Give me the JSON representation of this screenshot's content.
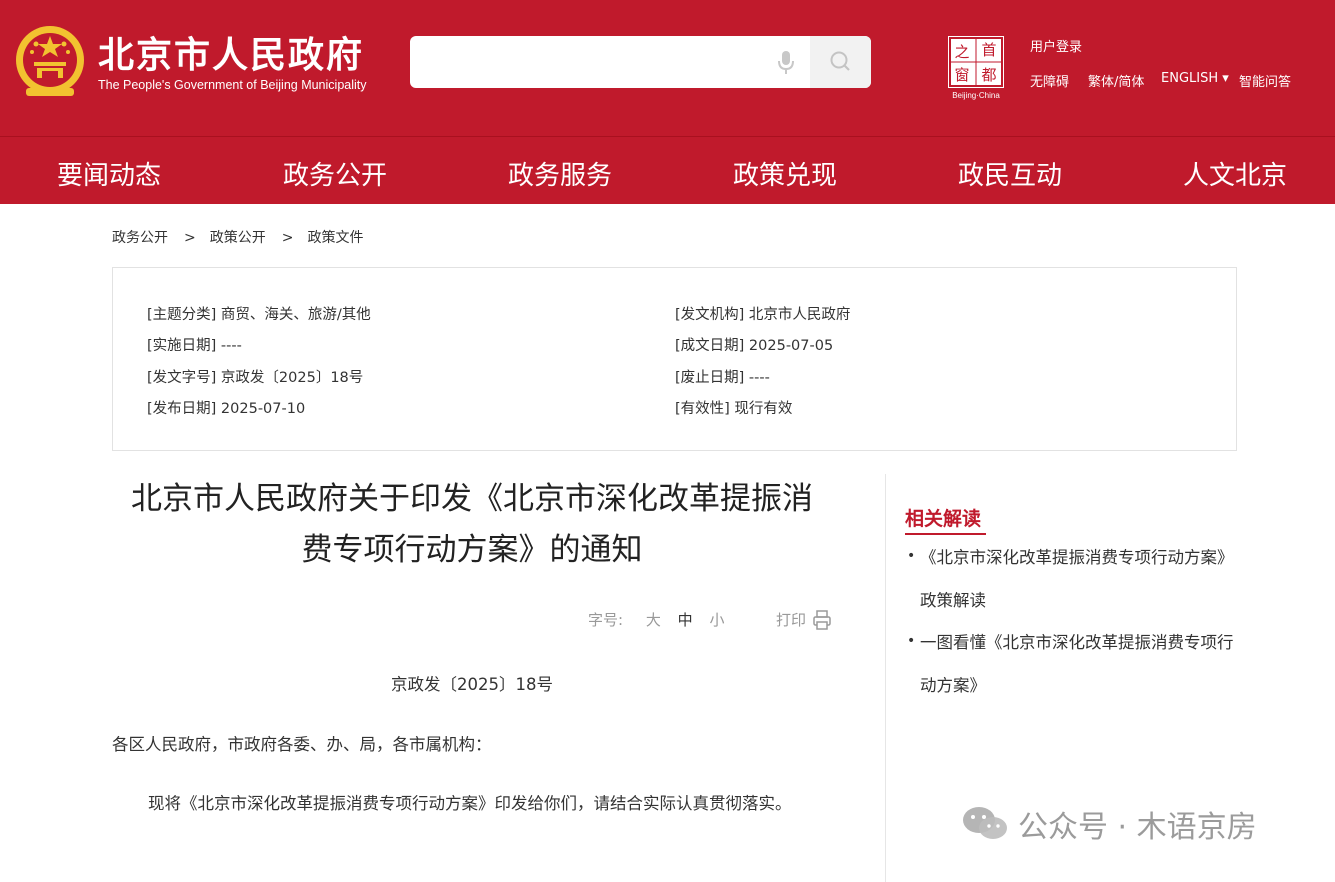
{
  "header": {
    "title_cn": "北京市人民政府",
    "title_en": "The People's Government of Beijing Municipality",
    "search_placeholder": "",
    "login": "用户登录",
    "utils": [
      "无障碍",
      "繁体/简体",
      "ENGLISH ▾",
      "智能问答"
    ],
    "capital_logo_text": [
      "之",
      "首",
      "窗",
      "都",
      "Beijing·China"
    ]
  },
  "nav": [
    "要闻动态",
    "政务公开",
    "政务服务",
    "政策兑现",
    "政民互动",
    "人文北京"
  ],
  "breadcrumb": [
    ">",
    ">"
  ],
  "breadcrumb_items": [
    "政务公开",
    "政策公开",
    "政策文件"
  ],
  "meta": {
    "left": [
      "[主题分类] 商贸、海关、旅游/其他",
      "[实施日期] ----",
      "[发文字号] 京政发〔2025〕18号",
      "[发布日期] 2025-07-10"
    ],
    "right": [
      "[发文机构] 北京市人民政府",
      "[成文日期] 2025-07-05",
      "[废止日期] ----",
      "[有效性] 现行有效"
    ]
  },
  "article": {
    "title_line1": "北京市人民政府关于印发《北京市深化改革提振消",
    "title_line2": "费专项行动方案》的通知",
    "font_label": "字号:",
    "font_sizes": [
      "大",
      "中",
      "小"
    ],
    "print": "打印",
    "doc_number": "京政发〔2025〕18号",
    "salutation": "各区人民政府，市政府各委、办、局，各市属机构：",
    "body": "现将《北京市深化改革提振消费专项行动方案》印发给你们，请结合实际认真贯彻落实。"
  },
  "related": {
    "title": "相关解读",
    "bullet": "•",
    "items": [
      "《北京市深化改革提振消费专项行动方案》政策解读",
      "一图看懂《北京市深化改革提振消费专项行动方案》"
    ]
  },
  "watermark": "公众号 · 木语京房",
  "colors": {
    "brand_red": "#c01a2c",
    "emblem_gold": "#f2c230"
  }
}
